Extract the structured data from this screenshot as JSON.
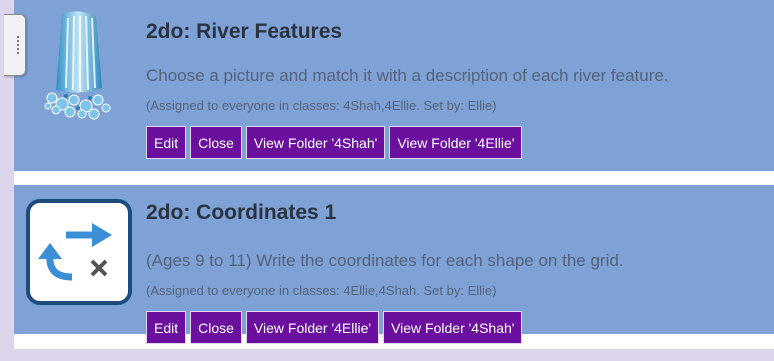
{
  "tasks": [
    {
      "title": "2do: River Features",
      "description": "Choose a picture and match it with a description of each river feature.",
      "assigned": "(Assigned to everyone in classes: 4Shah,4Ellie. Set by: Ellie)",
      "icon": "waterfall-icon",
      "buttons": [
        "Edit",
        "Close",
        "View Folder '4Shah'",
        "View Folder '4Ellie'"
      ]
    },
    {
      "title": "2do: Coordinates 1",
      "description": "(Ages 9 to 11) Write the coordinates for each shape on the grid.",
      "assigned": "(Assigned to everyone in classes: 4Ellie,4Shah. Set by: Ellie)",
      "icon": "coordinates-icon",
      "buttons": [
        "Edit",
        "Close",
        "View Folder '4Ellie'",
        "View Folder '4Shah'"
      ]
    }
  ],
  "colors": {
    "card": "#7fa2d6",
    "button": "#6a0f9e",
    "background": "#ddd5ec",
    "icon_accent": "#3a8fd6"
  }
}
